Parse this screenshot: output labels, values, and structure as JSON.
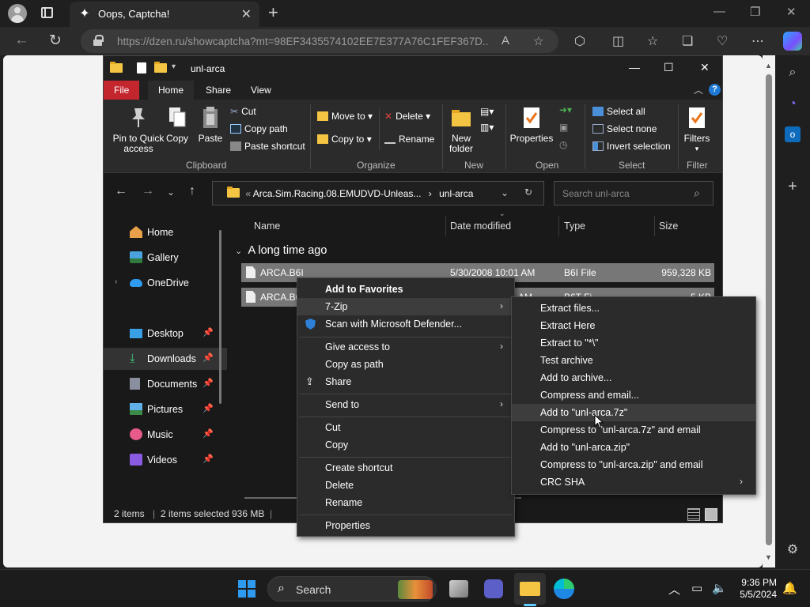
{
  "browser": {
    "tab_title": "Oops, Captcha!",
    "url": "https://dzen.ru/showcaptcha?mt=98EF3435574102EE7E377A76C1FEF367D...",
    "new_tab_label": "+",
    "accent": "#2e9bf0"
  },
  "explorer": {
    "title": "unl-arca",
    "ribbon_tabs": [
      "File",
      "Home",
      "Share",
      "View"
    ],
    "ribbon": {
      "pin_quick_access": "Pin to Quick access",
      "copy": "Copy",
      "paste": "Paste",
      "cut": "Cut",
      "copy_path": "Copy path",
      "paste_shortcut": "Paste shortcut",
      "move_to": "Move to",
      "copy_to": "Copy to",
      "delete": "Delete",
      "rename": "Rename",
      "new_folder": "New folder",
      "properties": "Properties",
      "select_all": "Select all",
      "select_none": "Select none",
      "invert_selection": "Invert selection",
      "filters": "Filters",
      "groups": [
        "Clipboard",
        "Organize",
        "New",
        "Open",
        "Select",
        "Filter"
      ]
    },
    "path": "Arca.Sim.Racing.08.EMUDVD-Unleas...",
    "path_current": "unl-arca",
    "path_prefix": "«",
    "search_placeholder": "Search unl-arca",
    "nav_items": [
      {
        "label": "Home",
        "icon": "home-icon"
      },
      {
        "label": "Gallery",
        "icon": "gallery-icon"
      },
      {
        "label": "OneDrive",
        "icon": "onedrive-icon"
      },
      {
        "label": "Desktop",
        "icon": "desktop-icon"
      },
      {
        "label": "Downloads",
        "icon": "download-icon"
      },
      {
        "label": "Documents",
        "icon": "documents-icon"
      },
      {
        "label": "Pictures",
        "icon": "pictures-icon"
      },
      {
        "label": "Music",
        "icon": "music-icon"
      },
      {
        "label": "Videos",
        "icon": "videos-icon"
      }
    ],
    "columns": [
      "Name",
      "Date modified",
      "Type",
      "Size"
    ],
    "group_header": "A long time ago",
    "files": [
      {
        "name": "ARCA.B6I",
        "date": "5/30/2008 10:01 AM",
        "type": "B6I File",
        "size": "959,328 KB"
      },
      {
        "name": "ARCA.B6",
        "date": "AM",
        "type": "B6T Fi",
        "size": "5 KB"
      }
    ],
    "status": {
      "items": "2 items",
      "selected": "2 items selected",
      "size": "936 MB"
    }
  },
  "context_menu": {
    "items": [
      "Add to Favorites",
      "7-Zip",
      "Scan with Microsoft Defender...",
      "Give access to",
      "Copy as path",
      "Share",
      "Send to",
      "Cut",
      "Copy",
      "Create shortcut",
      "Delete",
      "Rename",
      "Properties"
    ]
  },
  "submenu_7zip": {
    "items": [
      "Extract files...",
      "Extract Here",
      "Extract to \"*\\\"",
      "Test archive",
      "Add to archive...",
      "Compress and email...",
      "Add to \"unl-arca.7z\"",
      "Compress to \"unl-arca.7z\" and email",
      "Add to \"unl-arca.zip\"",
      "Compress to \"unl-arca.zip\" and email",
      "CRC SHA"
    ]
  },
  "taskbar": {
    "search_label": "Search",
    "time": "9:36 PM",
    "date": "5/5/2024"
  }
}
